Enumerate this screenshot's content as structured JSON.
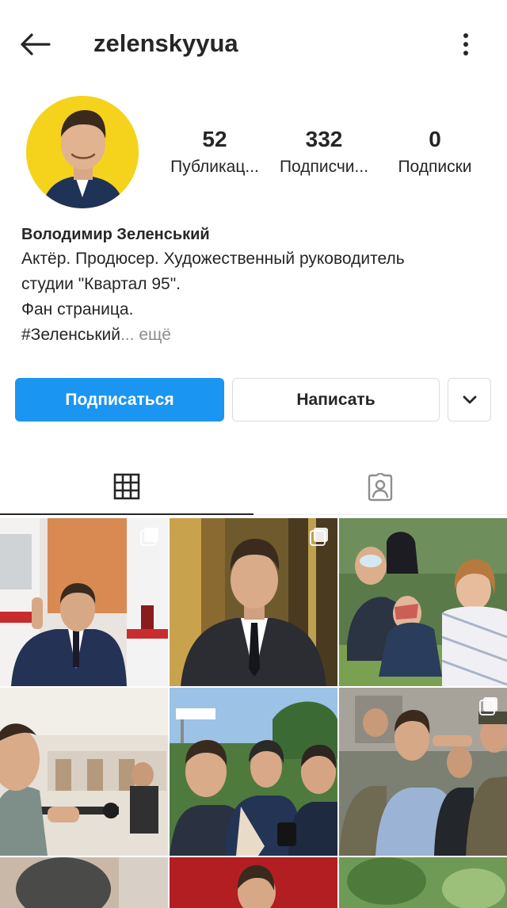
{
  "header": {
    "username": "zelenskyyua",
    "back_icon": "arrow-left-icon",
    "more_icon": "vertical-dots-icon"
  },
  "profile": {
    "avatar_color": "#f5d31c",
    "stats": [
      {
        "value": "52",
        "label": "Публикац..."
      },
      {
        "value": "332",
        "label": "Подписчи..."
      },
      {
        "value": "0",
        "label": "Подписки"
      }
    ],
    "name": "Володимир Зеленський",
    "bio_lines": [
      "Актёр. Продюсер. Художественный руководитель",
      "студии \"Квартал 95\".",
      "Фан страница."
    ],
    "bio_tag": "#Зеленський",
    "bio_ellipsis": "... ",
    "bio_more": "ещё"
  },
  "actions": {
    "follow_label": "Подписаться",
    "message_label": "Написать",
    "more_icon": "chevron-down-icon",
    "follow_color": "#1b95f2"
  },
  "tabs": [
    {
      "name": "grid",
      "icon": "grid-icon",
      "active": true
    },
    {
      "name": "tagged",
      "icon": "tagged-person-icon",
      "active": false
    }
  ]
}
